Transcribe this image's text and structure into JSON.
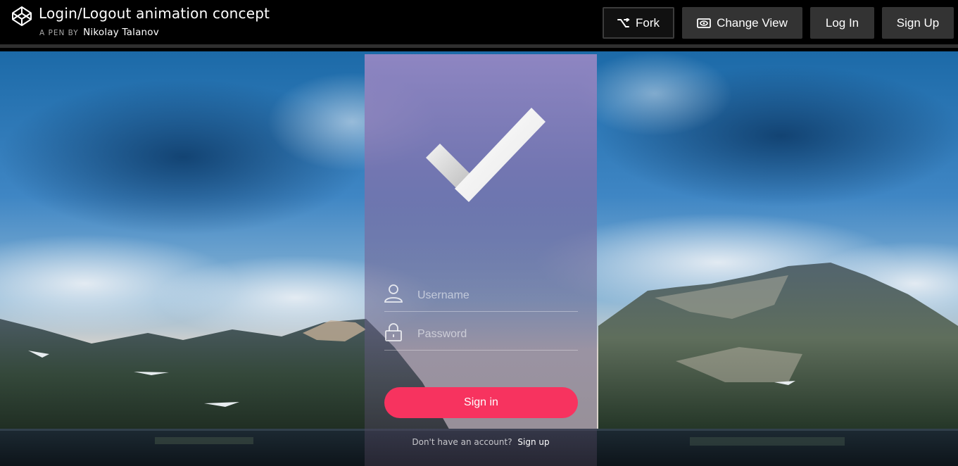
{
  "header": {
    "title": "Login/Logout animation concept",
    "by_label": "A PEN BY",
    "author": "Nikolay Talanov",
    "logo_icon": "codepen-logo",
    "buttons": {
      "fork": "Fork",
      "change_view": "Change View",
      "log_in": "Log In",
      "sign_up": "Sign Up"
    }
  },
  "login_card": {
    "check_icon": "check-mark-icon",
    "username_placeholder": "Username",
    "password_placeholder": "Password",
    "signin_label": "Sign in",
    "no_account_text": "Don't have an account?",
    "signup_link": "Sign up"
  },
  "colors": {
    "accent": "#f7335f",
    "topbar": "#000000",
    "button_bg": "#333333"
  }
}
